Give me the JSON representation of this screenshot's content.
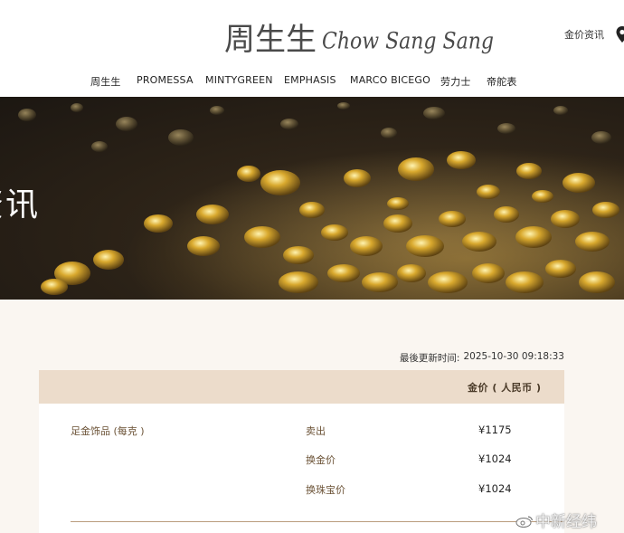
{
  "header": {
    "logo_cn": "周生生",
    "logo_en": "Chow Sang Sang",
    "gold_info_link": "金价资讯"
  },
  "nav": {
    "items": [
      {
        "label": "周生生"
      },
      {
        "label": "PROMESSA"
      },
      {
        "label": "MINTYGREEN"
      },
      {
        "label": "EMPHASIS"
      },
      {
        "label": "MARCO BICEGO"
      },
      {
        "label": "劳力士"
      },
      {
        "label": "帝舵表"
      }
    ]
  },
  "hero": {
    "title": "资讯"
  },
  "update": {
    "label": "最後更新时间:",
    "timestamp": "2025-10-30 09:18:33"
  },
  "price_table": {
    "price_header": "金价 ( 人民币 )",
    "product": "足金饰品 (每克 )",
    "rows": [
      {
        "label": "卖出",
        "value": "¥1175"
      },
      {
        "label": "换金价",
        "value": "¥1024"
      },
      {
        "label": "换珠宝价",
        "value": "¥1024"
      }
    ]
  },
  "watermark": {
    "text": "中新经纬"
  },
  "colors": {
    "table_header_bg": "#ecdccb",
    "content_bg": "#faf6f1",
    "accent_brown": "#6b5236",
    "divider": "#b99b7d"
  }
}
